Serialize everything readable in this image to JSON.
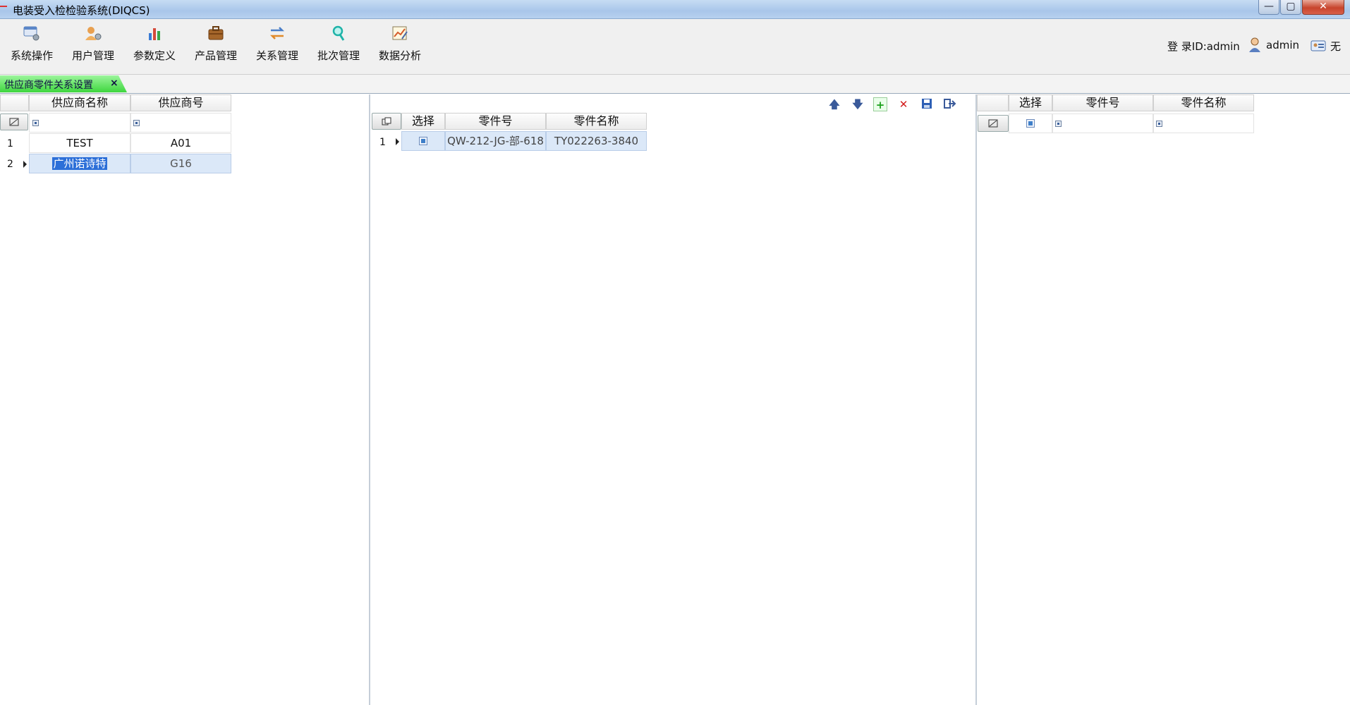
{
  "window": {
    "title": "电装受入检检验系统(DIQCS)",
    "min_glyph": "—",
    "max_glyph": "▢",
    "close_glyph": "✕"
  },
  "toolbar": {
    "items": [
      {
        "label": "系统操作",
        "icon": "system-settings-icon"
      },
      {
        "label": "用户管理",
        "icon": "user-manage-icon"
      },
      {
        "label": "参数定义",
        "icon": "bar-chart-icon"
      },
      {
        "label": "产品管理",
        "icon": "briefcase-icon"
      },
      {
        "label": "关系管理",
        "icon": "swap-arrows-icon"
      },
      {
        "label": "批次管理",
        "icon": "magnifier-icon"
      },
      {
        "label": "数据分析",
        "icon": "chart-edit-icon"
      }
    ],
    "login_id": "登 录ID:admin",
    "user": "admin",
    "department": "无"
  },
  "tabs": [
    {
      "label": "供应商零件关系设置",
      "close": "×",
      "active": true
    }
  ],
  "supplier_grid": {
    "columns": [
      "供应商名称",
      "供应商号"
    ],
    "rows": [
      {
        "num": "1",
        "name": "TEST",
        "code": "A01"
      },
      {
        "num": "2",
        "name": "广州诺诗特",
        "code": "G16"
      }
    ]
  },
  "part_grid": {
    "columns": [
      "选择",
      "零件号",
      "零件名称"
    ],
    "rows": [
      {
        "num": "1",
        "part_no": "QW-212-JG-部-618",
        "part_name": "TY022263-3840"
      }
    ],
    "actions": [
      "move-up",
      "move-down",
      "add",
      "delete",
      "save",
      "exit"
    ]
  },
  "available_grid": {
    "columns": [
      "选择",
      "零件号",
      "零件名称"
    ],
    "rows": []
  },
  "colors": {
    "tab_green": "#3ed63e",
    "selection_blue": "#2c6fd8",
    "selected_row": "#dbe8f8"
  }
}
